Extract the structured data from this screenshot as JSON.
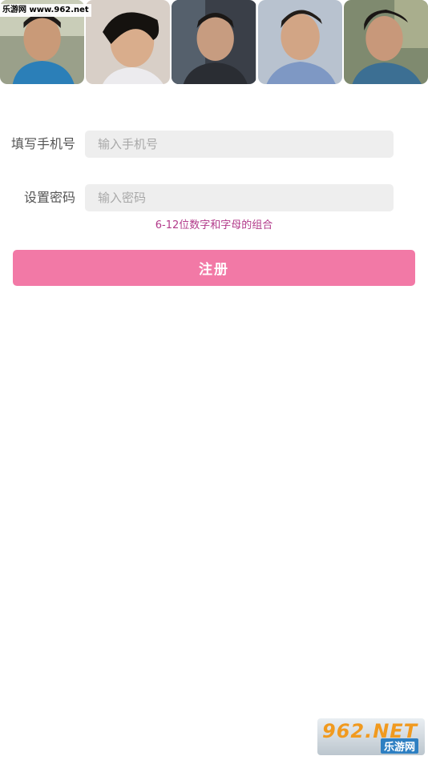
{
  "watermark": {
    "top_text": "乐游网 www.962.net",
    "logo_main": "962.NET",
    "logo_sub": "乐游网"
  },
  "photos": [
    {
      "alt": "portrait-1"
    },
    {
      "alt": "portrait-2"
    },
    {
      "alt": "portrait-3"
    },
    {
      "alt": "portrait-4"
    },
    {
      "alt": "portrait-5"
    }
  ],
  "form": {
    "phone": {
      "label": "填写手机号",
      "placeholder": "输入手机号",
      "value": ""
    },
    "password": {
      "label": "设置密码",
      "placeholder": "输入密码",
      "value": ""
    },
    "hint": "6-12位数字和字母的组合"
  },
  "actions": {
    "register_label": "注册"
  },
  "colors": {
    "accent": "#f279a6",
    "hint": "#b23a8a",
    "input_bg": "#eeeeee"
  }
}
